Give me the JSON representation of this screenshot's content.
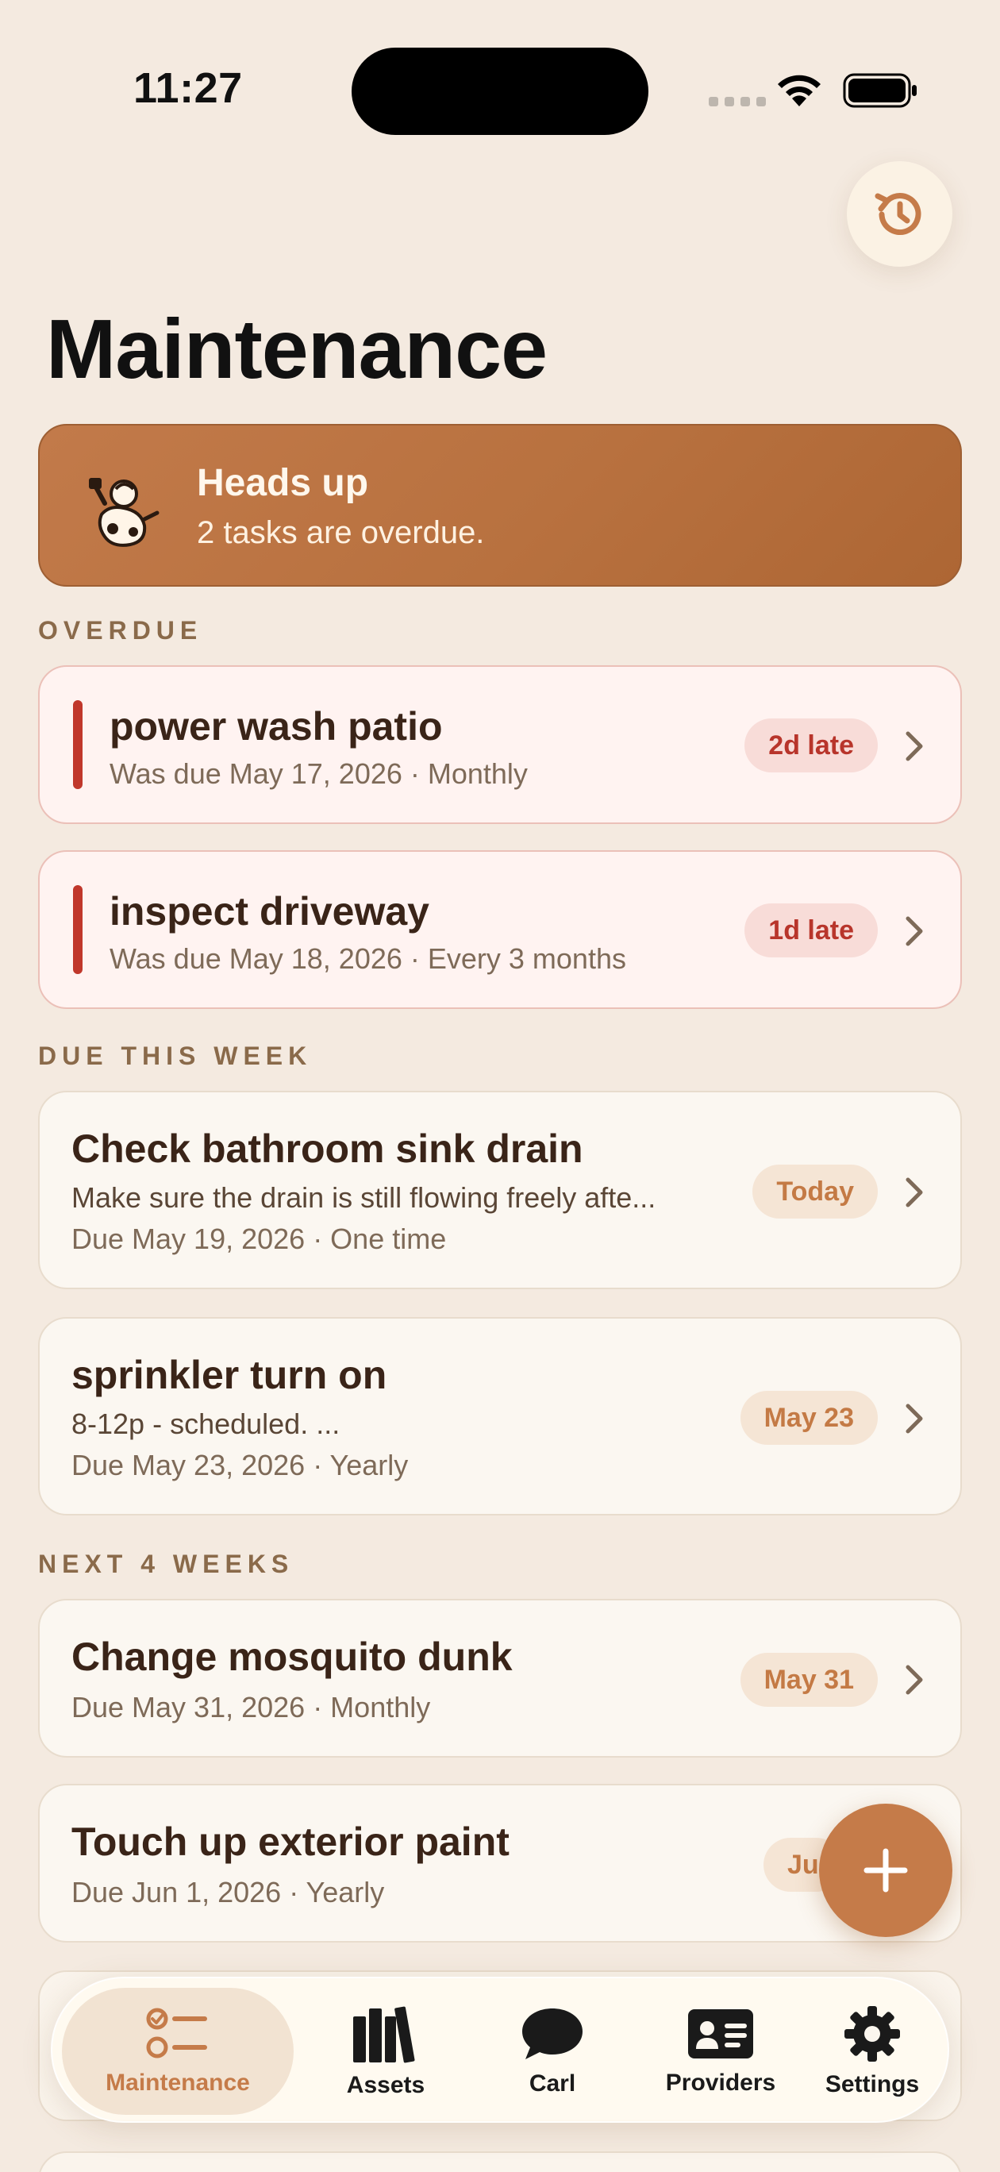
{
  "status_bar": {
    "time": "11:27"
  },
  "header": {
    "title": "Maintenance",
    "history_icon": "history-icon"
  },
  "banner": {
    "title": "Heads up",
    "subtitle": "2 tasks are overdue."
  },
  "sections": {
    "overdue": "OVERDUE",
    "due_this_week": "DUE THIS WEEK",
    "next_4_weeks": "NEXT 4 WEEKS"
  },
  "overdue_tasks": [
    {
      "title": "power wash patio",
      "meta": "Was due May 17, 2026 · Monthly",
      "badge": "2d late"
    },
    {
      "title": "inspect driveway",
      "meta": "Was due May 18, 2026 · Every 3 months",
      "badge": "1d late"
    }
  ],
  "week_tasks": [
    {
      "title": "Check bathroom sink drain",
      "note": "Make sure the drain is still flowing freely afte...",
      "meta": "Due May 19, 2026 · One time",
      "badge": "Today"
    },
    {
      "title": "sprinkler turn on",
      "note": "8-12p - scheduled. ...",
      "meta": "Due May 23, 2026 · Yearly",
      "badge": "May 23"
    }
  ],
  "month_tasks": [
    {
      "title": "Change mosquito dunk",
      "meta": "Due May 31, 2026 · Monthly",
      "badge": "May 31"
    },
    {
      "title": "Touch up exterior paint",
      "meta": "Due Jun 1, 2026 · Yearly",
      "badge": "Ju"
    }
  ],
  "tabs": [
    {
      "label": "Maintenance",
      "icon": "checklist-icon",
      "active": true
    },
    {
      "label": "Assets",
      "icon": "books-icon"
    },
    {
      "label": "Carl",
      "icon": "chat-bubble-icon"
    },
    {
      "label": "Providers",
      "icon": "contact-card-icon"
    },
    {
      "label": "Settings",
      "icon": "gear-icon"
    }
  ],
  "colors": {
    "background": "#F4EAE0",
    "accent": "#C57B49",
    "overdue_red": "#C0372B",
    "banner": "#B8713F"
  }
}
